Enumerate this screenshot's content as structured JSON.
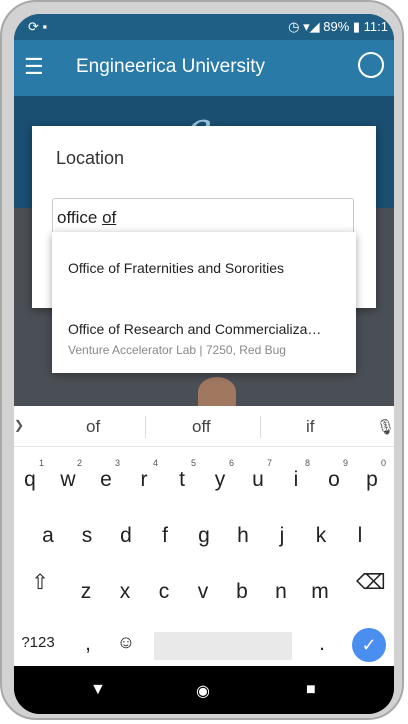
{
  "status_bar": {
    "left": "⟳ ▪",
    "right": "◷ ▾◢ 89% ▮ 11:1"
  },
  "app_bar": {
    "title": "Engineerica University",
    "menu_icon": "menu-icon",
    "user_icon": "user-icon"
  },
  "dialog": {
    "title": "Location",
    "input_value": "office of",
    "input_prefix": "office ",
    "input_underlined": "of"
  },
  "suggestions": [
    {
      "label": "Office of Fraternities and Sororities",
      "subtitle": ""
    },
    {
      "label": "Office of Research and Commercializa…",
      "subtitle": "Venture Accelerator Lab  | 7250, Red Bug"
    }
  ],
  "keyboard": {
    "word_suggestions": [
      "of",
      "off",
      "if"
    ],
    "row1": [
      "q",
      "w",
      "e",
      "r",
      "t",
      "y",
      "u",
      "i",
      "o",
      "p"
    ],
    "row1_nums": [
      "1",
      "2",
      "3",
      "4",
      "5",
      "6",
      "7",
      "8",
      "9",
      "0"
    ],
    "row2": [
      "a",
      "s",
      "d",
      "f",
      "g",
      "h",
      "j",
      "k",
      "l"
    ],
    "row3": [
      "z",
      "x",
      "c",
      "v",
      "b",
      "n",
      "m"
    ],
    "symbols_label": "?123",
    "comma": ",",
    "period": ".",
    "enter_icon": "check-icon"
  },
  "colors": {
    "app_bar": "#2a7aa8",
    "status_bar": "#1f5f85",
    "enter": "#4a8ef0"
  }
}
